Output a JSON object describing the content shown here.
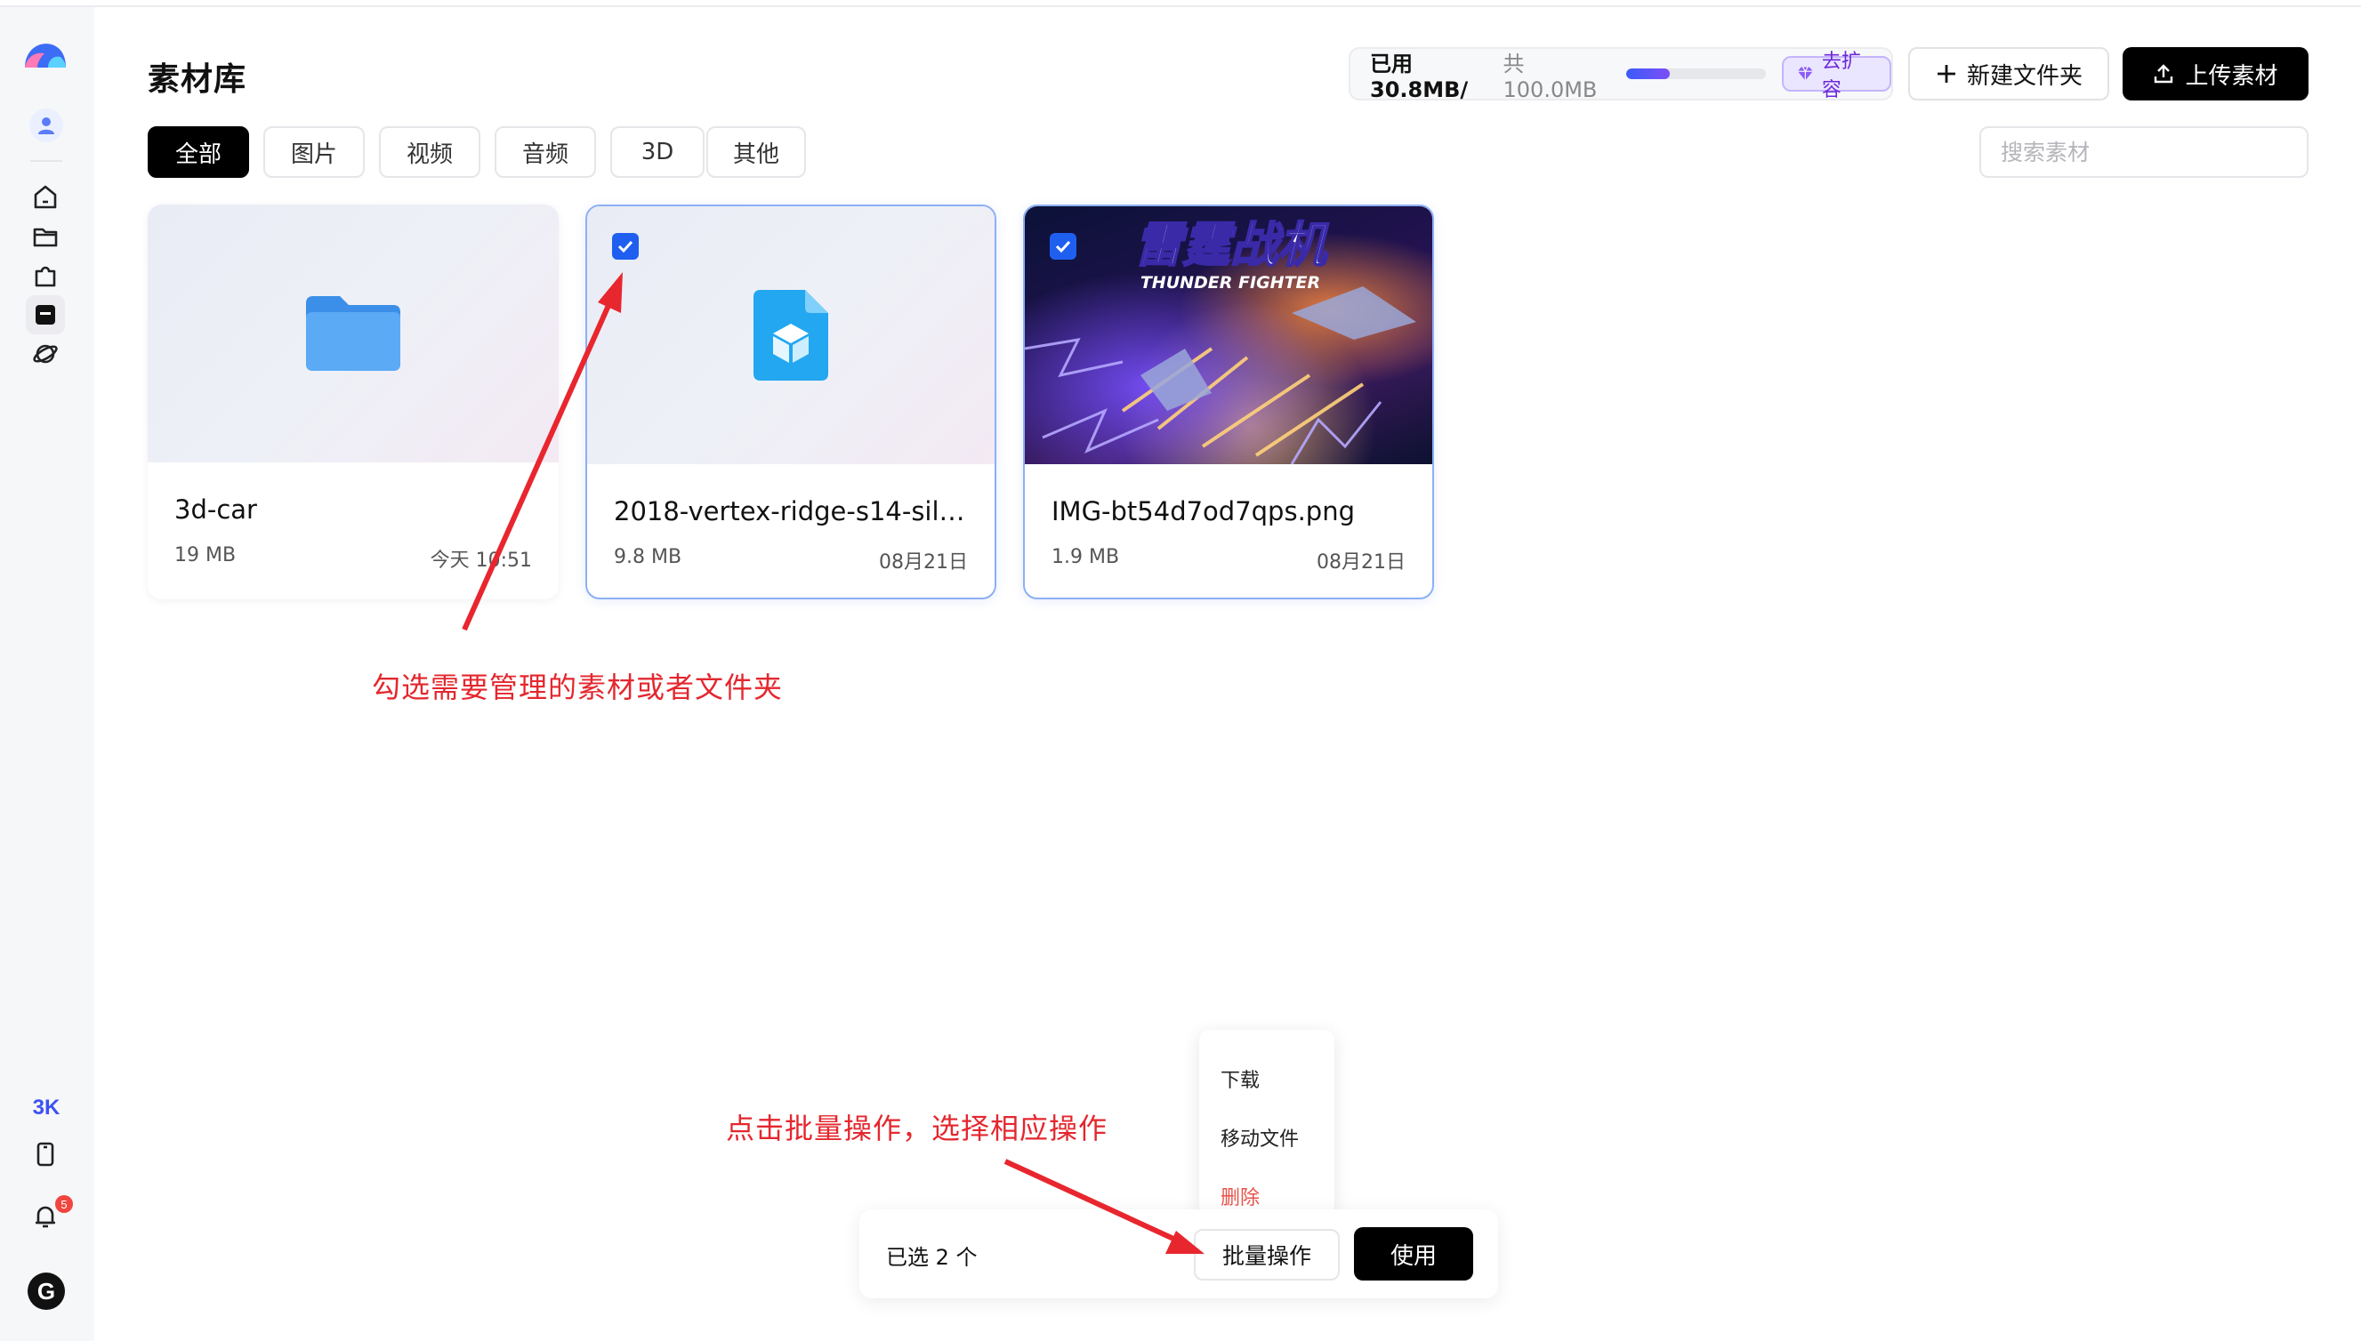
{
  "page": {
    "title": "素材库"
  },
  "storage": {
    "used_label": "已用30.8MB/",
    "total_label": "共100.0MB",
    "used_fraction": 0.308,
    "expand_label": "去扩容"
  },
  "header_actions": {
    "new_folder_label": "新建文件夹",
    "upload_label": "上传素材"
  },
  "tabs": [
    {
      "label": "全部",
      "active": true
    },
    {
      "label": "图片",
      "active": false
    },
    {
      "label": "视频",
      "active": false
    },
    {
      "label": "音频",
      "active": false
    },
    {
      "label": "3D",
      "active": false
    },
    {
      "label": "其他",
      "active": false
    }
  ],
  "search": {
    "placeholder": "搜索素材"
  },
  "cards": [
    {
      "name": "3d-car",
      "size": "19 MB",
      "date": "今天 10:51",
      "type": "folder",
      "selected": false
    },
    {
      "name": "2018-vertex-ridge-s14-silvi...",
      "size": "9.8 MB",
      "date": "08月21日",
      "type": "3d-model",
      "selected": true
    },
    {
      "name": "IMG-bt54d7od7qps.png",
      "size": "1.9 MB",
      "date": "08月21日",
      "type": "image",
      "selected": true,
      "image_title": "雷霆战机",
      "image_subtitle": "THUNDER FIGHTER"
    }
  ],
  "sidebar": {
    "badge_3k": "3K",
    "notification_count": "5",
    "user_initial": "G"
  },
  "annotations": {
    "select_hint": "勾选需要管理的素材或者文件夹",
    "batch_hint": "点击批量操作，选择相应操作"
  },
  "batch_menu": {
    "items": [
      {
        "label": "下载"
      },
      {
        "label": "移动文件"
      },
      {
        "label": "删除"
      }
    ]
  },
  "bottom_bar": {
    "selected_text": "已选 2 个",
    "batch_label": "批量操作",
    "use_label": "使用"
  },
  "colors": {
    "accent": "#1f5ff0",
    "annotation": "#e4272e",
    "danger": "#e8534a",
    "primary_button": "#000000"
  }
}
